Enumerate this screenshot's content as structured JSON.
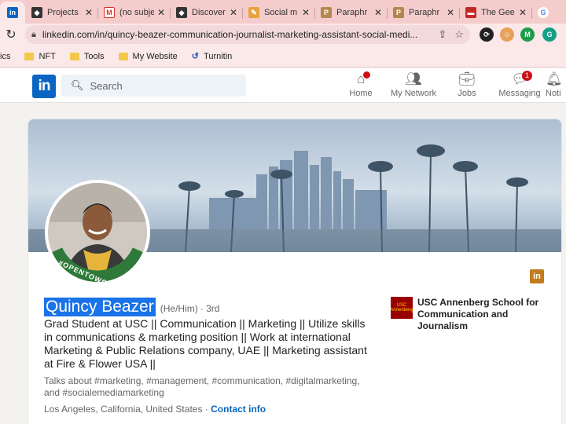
{
  "browser": {
    "tabs": [
      {
        "label": "",
        "icon": "linkedin-icon",
        "color": "#0a66c2",
        "active": true
      },
      {
        "label": "Projects",
        "icon": "projects-icon",
        "color": "#333333"
      },
      {
        "label": "(no subje",
        "icon": "gmail-icon",
        "color": "#d93025"
      },
      {
        "label": "Discover",
        "icon": "discover-icon",
        "color": "#333333"
      },
      {
        "label": "Social m",
        "icon": "social-icon",
        "color": "#e8a33c"
      },
      {
        "label": "Paraphr",
        "icon": "paraphrase-icon",
        "color": "#b5874f"
      },
      {
        "label": "Paraphr",
        "icon": "paraphrase-icon",
        "color": "#b5874f"
      },
      {
        "label": "The Gee",
        "icon": "car-icon",
        "color": "#c62828"
      },
      {
        "label": "G",
        "icon": "google-icon",
        "color": "#4285f4"
      }
    ],
    "url": "linkedin.com/in/quincy-beazer-communication-journalist-marketing-assistant-social-medi...",
    "bookmarks": [
      {
        "label": "ics",
        "folder": false
      },
      {
        "label": "NFT",
        "folder": true
      },
      {
        "label": "Tools",
        "folder": true
      },
      {
        "label": "My Website",
        "folder": true
      },
      {
        "label": "Turnitin",
        "folder": false
      }
    ]
  },
  "linkedin": {
    "logo": "in",
    "search_placeholder": "Search",
    "nav": [
      {
        "label": "Home",
        "icon": "home-icon",
        "badge": ""
      },
      {
        "label": "My Network",
        "icon": "network-icon",
        "badge": ""
      },
      {
        "label": "Jobs",
        "icon": "jobs-icon",
        "badge": ""
      },
      {
        "label": "Messaging",
        "icon": "messaging-icon",
        "badge": "1"
      },
      {
        "label": "Noti",
        "icon": "notifications-icon",
        "badge": ""
      }
    ]
  },
  "profile": {
    "name": "Quincy Beazer",
    "pronouns": "(He/Him)",
    "degree": "· 3rd",
    "headline": "Grad Student at USC || Communication || Marketing || Utilize skills in communications & marketing position || Work at international Marketing & Public Relations company, UAE || Marketing assistant at Fire & Flower USA ||",
    "talks_about": "Talks about #marketing, #management, #communication, #digitalmarketing, and #socialemediamarketing",
    "location": "Los Angeles, California, United States",
    "location_sep": " · ",
    "contact_info": "Contact info",
    "open_to_work": "#OPENTOWORK",
    "school": "USC Annenberg School for Communication and Journalism",
    "school_logo_text": "USC Annenberg"
  }
}
